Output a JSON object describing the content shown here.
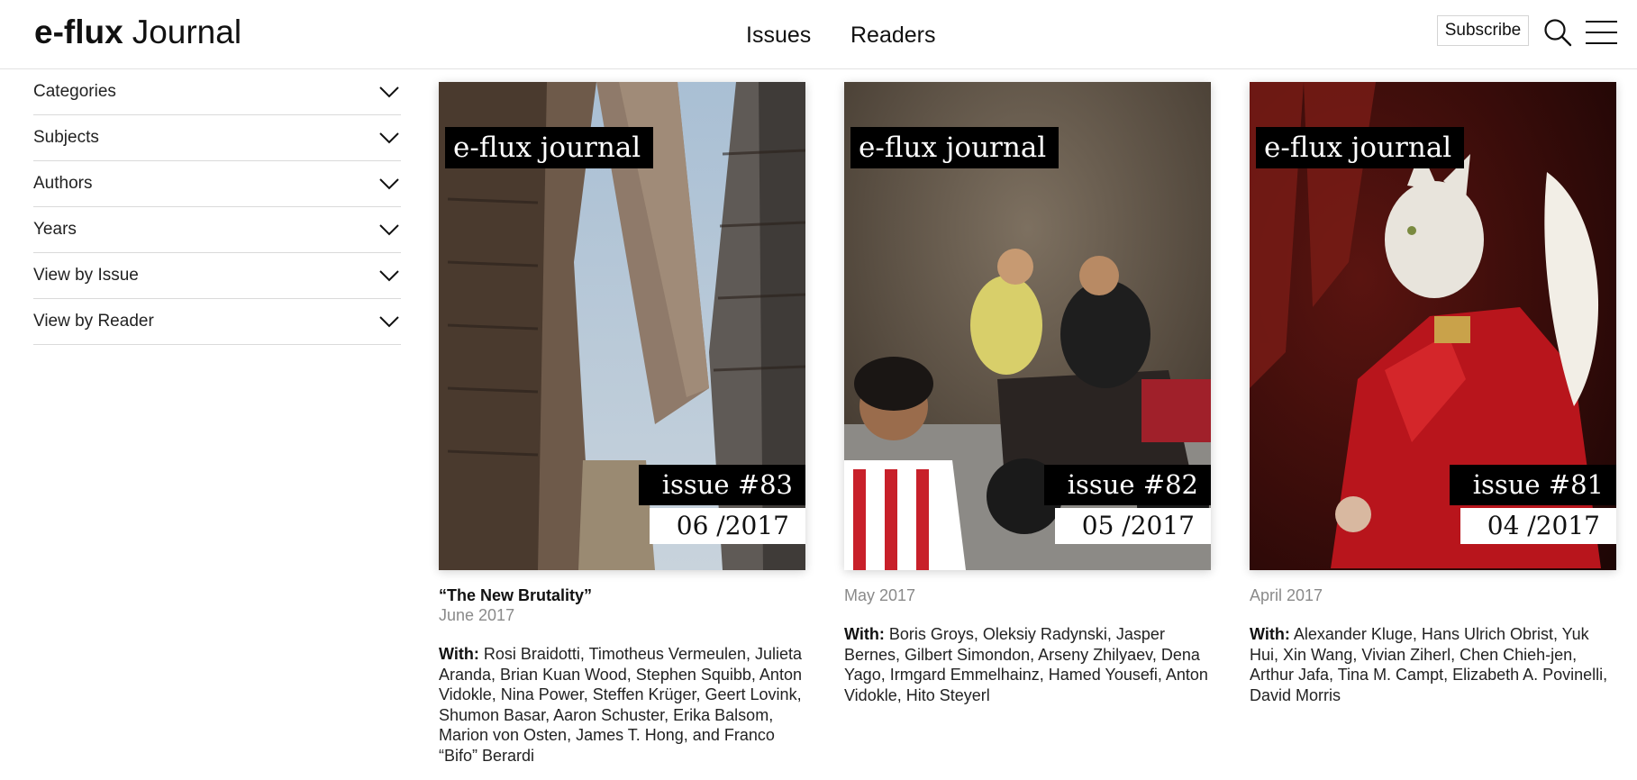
{
  "header": {
    "logo_brand": "e-flux",
    "logo_sub": "Journal",
    "nav": [
      "Issues",
      "Readers"
    ],
    "subscribe_label": "Subscribe",
    "search_icon": "search-icon",
    "menu_icon": "hamburger-menu-icon"
  },
  "sidebar": {
    "filters": [
      {
        "label": "Categories"
      },
      {
        "label": "Subjects"
      },
      {
        "label": "Authors"
      },
      {
        "label": "Years"
      },
      {
        "label": "View by Issue"
      },
      {
        "label": "View by Reader"
      }
    ],
    "chevron_icon": "chevron-down-icon"
  },
  "issues": [
    {
      "cover_title": "e-flux journal",
      "issue_label": "issue #83",
      "issue_date": "06 /2017",
      "title": "“The New Brutality”",
      "date": "June 2017",
      "with_label": "With:",
      "with_names": "Rosi Braidotti, Timotheus Vermeulen, Julieta Aranda, Brian Kuan Wood, Stephen Squibb, Anton Vidokle, Nina Power, Steffen Krüger, Geert Lovink, Shumon Basar, Aaron Schuster, Erika Balsom, Marion von Osten, James T. Hong, and Franco “Bifo” Berardi"
    },
    {
      "cover_title": "e-flux journal",
      "issue_label": "issue #82",
      "issue_date": "05 /2017",
      "date": "May 2017",
      "with_label": "With:",
      "with_names": "Boris Groys, Oleksiy Radynski, Jasper Bernes, Gilbert Simondon, Arseny Zhilyaev, Dena Yago, Irmgard Emmelhainz, Hamed Yousefi, Anton Vidokle, Hito Steyerl"
    },
    {
      "cover_title": "e-flux journal",
      "issue_label": "issue #81",
      "issue_date": "04 /2017",
      "date": "April 2017",
      "with_label": "With:",
      "with_names": "Alexander Kluge, Hans Ulrich Obrist, Yuk Hui, Xin Wang, Vivian Ziherl, Chen Chieh-jen, Arthur Jafa, Tina M. Campt, Elizabeth A. Povinelli, David Morris"
    }
  ]
}
